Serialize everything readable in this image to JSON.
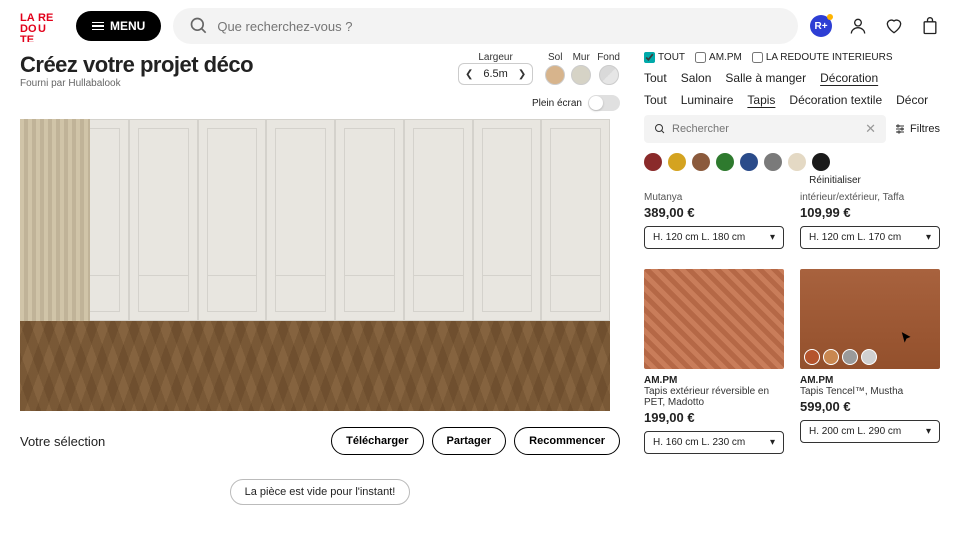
{
  "header": {
    "menu_label": "MENU",
    "search_placeholder": "Que recherchez-vous ?",
    "r_badge": "R+"
  },
  "planner": {
    "title": "Créez votre projet déco",
    "subtitle": "Fourni par Hullabalook",
    "width_label": "Largeur",
    "width_value": "6.5m",
    "tex": {
      "sol": "Sol",
      "mur": "Mur",
      "fond": "Fond"
    },
    "fullscreen_label": "Plein écran",
    "selection_label": "Votre sélection",
    "buttons": {
      "download": "Télécharger",
      "share": "Partager",
      "restart": "Recommencer"
    },
    "empty_msg": "La pièce est vide pour l'instant!"
  },
  "catalog": {
    "brands": {
      "all": "TOUT",
      "ampm": "AM.PM",
      "laredoute": "LA REDOUTE INTERIEURS"
    },
    "cat_tabs": [
      "Tout",
      "Salon",
      "Salle à manger",
      "Décoration"
    ],
    "sub_tabs": [
      "Tout",
      "Luminaire",
      "Tapis",
      "Décoration textile",
      "Décor"
    ],
    "search_placeholder": "Rechercher",
    "filters_label": "Filtres",
    "reset_label": "Réinitialiser",
    "colors": [
      "#8a2a2a",
      "#d4a320",
      "#8b5a3c",
      "#2e7a2e",
      "#2a4b8a",
      "#7a7a7a",
      "#e4d9c4",
      "#1a1a1a"
    ],
    "partial": {
      "p1": {
        "brand": "Mutanya",
        "price": "389,00 €",
        "size": "H. 120 cm L. 180 cm"
      },
      "p2": {
        "name": "intérieur/extérieur, Taffa",
        "price": "109,99 €",
        "size": "H. 120 cm L. 170 cm"
      }
    },
    "products": {
      "p3": {
        "brand": "AM.PM",
        "name": "Tapis extérieur réversible en PET, Madotto",
        "price": "199,00 €",
        "size": "H. 160 cm L. 230 cm"
      },
      "p4": {
        "brand": "AM.PM",
        "name": "Tapis Tencel™, Mustha",
        "price": "599,00 €",
        "size": "H. 200 cm L. 290 cm"
      }
    }
  }
}
